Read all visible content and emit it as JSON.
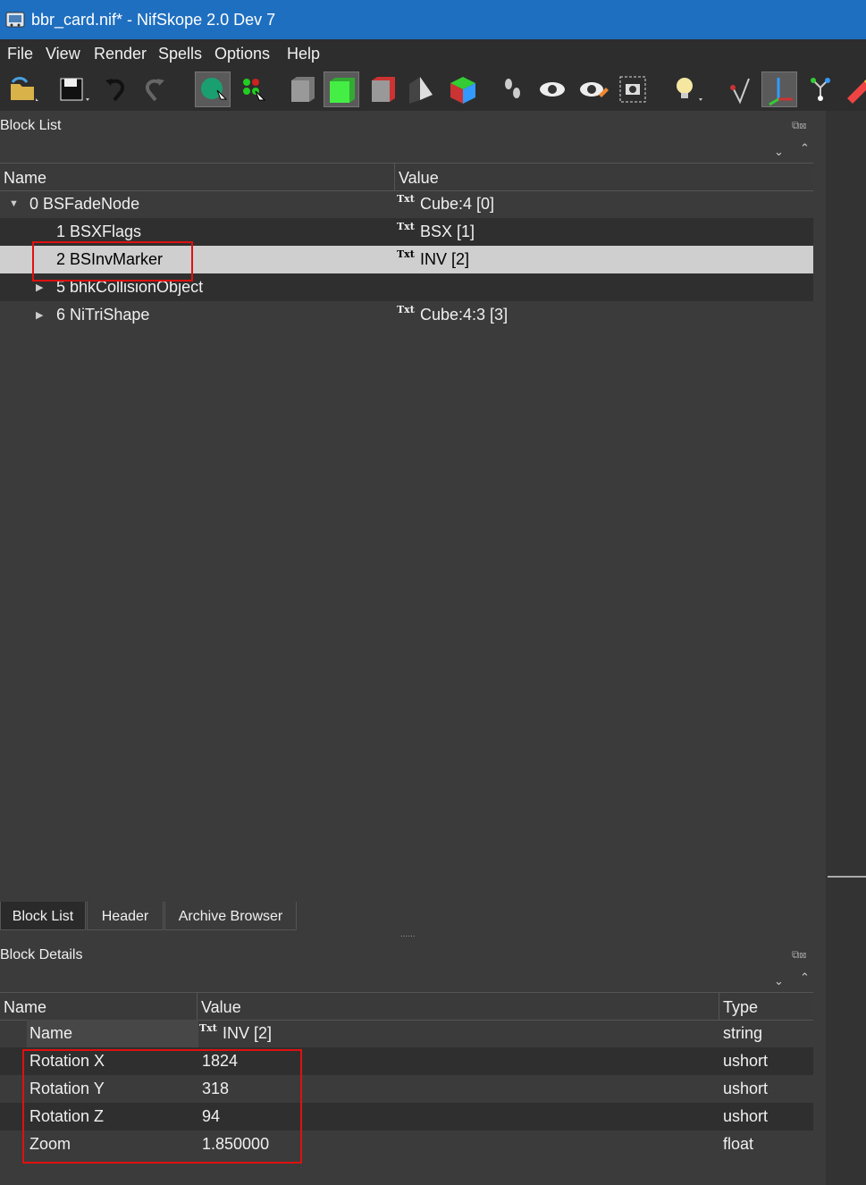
{
  "window": {
    "title": "bbr_card.nif* - NifSkope 2.0 Dev 7"
  },
  "menu": [
    "File",
    "View",
    "Render",
    "Spells",
    "Options",
    "Help"
  ],
  "block_list": {
    "title": "Block List",
    "columns": [
      "Name",
      "Value"
    ],
    "rows": [
      {
        "name": "0 BSFadeNode",
        "value": "Cube:4 [0]",
        "icon": "Txt",
        "expand": "expanded"
      },
      {
        "name": "1 BSXFlags",
        "value": "BSX [1]",
        "icon": "Txt",
        "expand": ""
      },
      {
        "name": "2 BSInvMarker",
        "value": "INV [2]",
        "icon": "Txt",
        "expand": ""
      },
      {
        "name": "5 bhkCollisionObject",
        "value": "",
        "icon": "",
        "expand": "collapsed"
      },
      {
        "name": "6 NiTriShape",
        "value": "Cube:4:3 [3]",
        "icon": "Txt",
        "expand": "collapsed"
      }
    ]
  },
  "tabs": [
    "Block List",
    "Header",
    "Archive Browser"
  ],
  "block_details": {
    "title": "Block Details",
    "columns": [
      "Name",
      "Value",
      "Type"
    ],
    "rows": [
      {
        "name": "Name",
        "value": "INV [2]",
        "type": "string",
        "icon": "Txt"
      },
      {
        "name": "Rotation X",
        "value": "1824",
        "type": "ushort",
        "icon": ""
      },
      {
        "name": "Rotation Y",
        "value": "318",
        "type": "ushort",
        "icon": ""
      },
      {
        "name": "Rotation Z",
        "value": "94",
        "type": "ushort",
        "icon": ""
      },
      {
        "name": "Zoom",
        "value": "1.850000",
        "type": "float",
        "icon": ""
      }
    ]
  },
  "colors": {
    "titlebar": "#1f6fc0",
    "highlight": "#e01010",
    "selection": "#cfcfcf"
  }
}
